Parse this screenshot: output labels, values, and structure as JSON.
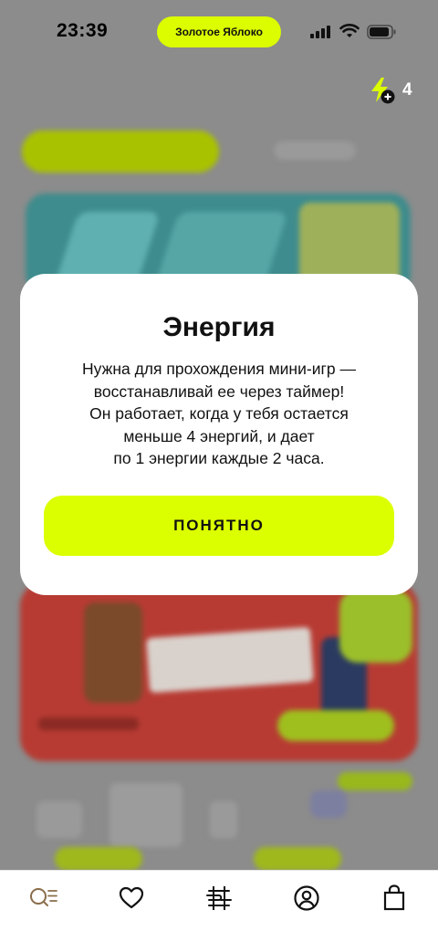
{
  "status_bar": {
    "time": "23:39",
    "island_label": "Золотое Яблоко",
    "icons": [
      "signal-icon",
      "wifi-icon",
      "battery-icon"
    ]
  },
  "energy": {
    "icon": "bolt-plus-icon",
    "count": "4",
    "accent": "#dcff00"
  },
  "modal": {
    "title": "Энергия",
    "body_lines": [
      "Нужна для прохождения мини-игр —",
      "восстанавливай ее через таймер!",
      "Он работает, когда у тебя остается",
      "меньше 4 энергий, и дает",
      "по 1 энергии каждые 2 часа."
    ],
    "button_label": "ПОНЯТНО",
    "button_color": "#dcff00"
  },
  "tabbar": {
    "items": [
      {
        "icon": "search-icon",
        "name": "tab-search"
      },
      {
        "icon": "heart-icon",
        "name": "tab-favorites"
      },
      {
        "icon": "catalog-icon",
        "name": "tab-catalog"
      },
      {
        "icon": "profile-icon",
        "name": "tab-profile"
      },
      {
        "icon": "bag-icon",
        "name": "tab-cart"
      }
    ],
    "active_color": "#8a6d4a"
  }
}
